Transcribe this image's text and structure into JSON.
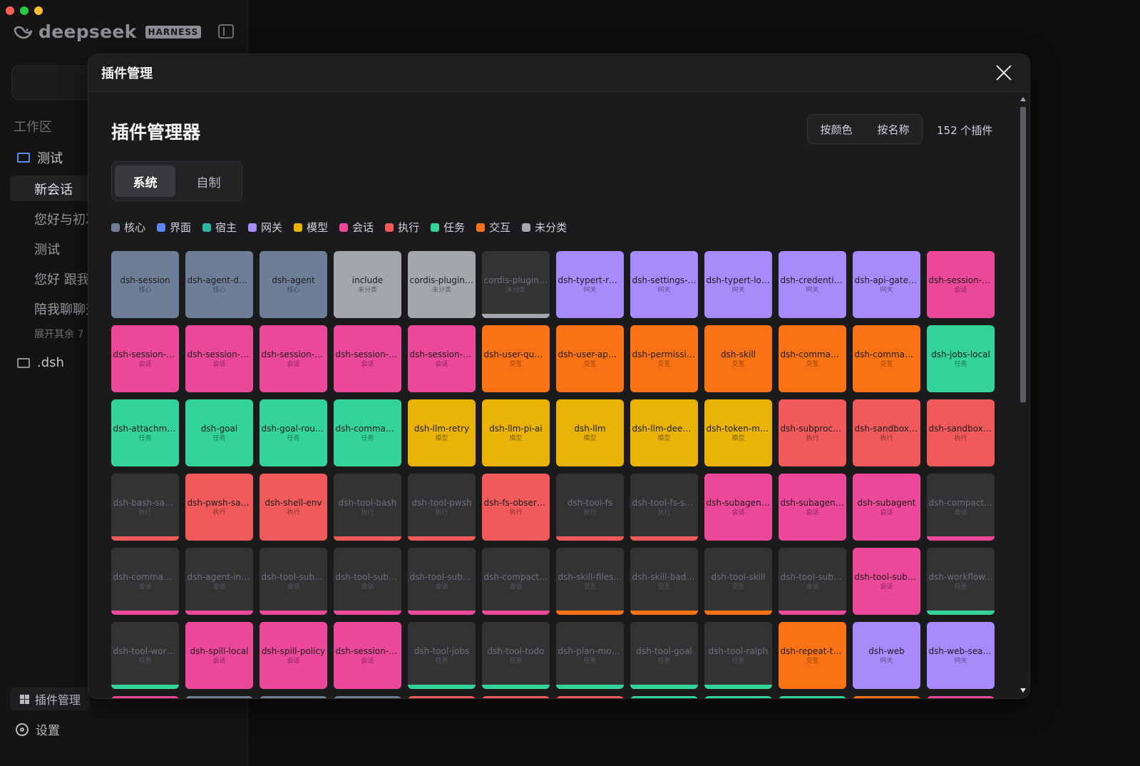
{
  "brand": {
    "name": "deepseek",
    "badge": "HARNESS"
  },
  "sidebar": {
    "workspace_title": "工作区",
    "items": [
      {
        "label": "测试",
        "type": "folder"
      },
      {
        "label": "新会话",
        "type": "chat"
      },
      {
        "label": "您好与初次",
        "type": "chat"
      },
      {
        "label": "测试",
        "type": "chat"
      },
      {
        "label": "您好 跟我",
        "type": "chat"
      },
      {
        "label": "陪我聊聊天",
        "type": "chat"
      },
      {
        "label": "展开其余 7",
        "type": "more"
      },
      {
        "label": ".dsh",
        "type": "folder"
      }
    ],
    "plugin_manager": "插件管理",
    "settings": "设置"
  },
  "modal": {
    "title": "插件管理",
    "heading": "插件管理器",
    "sort_by_color": "按颜色",
    "sort_by_name": "按名称",
    "count": "152 个插件",
    "tabs": [
      "系统",
      "自制"
    ],
    "active_tab": "系统"
  },
  "colors": {
    "核心": "#6f7e97",
    "界面": "#5b84f0",
    "宿主": "#2bb8a3",
    "网关": "#a78bfa",
    "模型": "#eab308",
    "会话": "#ec4899",
    "执行": "#f05a5a",
    "任务": "#34d399",
    "交互": "#f97316",
    "未分类": "#a3a6ab"
  },
  "legend": [
    "核心",
    "界面",
    "宿主",
    "网关",
    "模型",
    "会话",
    "执行",
    "任务",
    "交互",
    "未分类"
  ],
  "plugins": [
    {
      "name": "dsh-session",
      "cat": "核心",
      "on": true
    },
    {
      "name": "dsh-agent-def...",
      "cat": "核心",
      "on": true
    },
    {
      "name": "dsh-agent",
      "cat": "核心",
      "on": true
    },
    {
      "name": "include",
      "cat": "未分类",
      "on": true
    },
    {
      "name": "cordis-plugin-...",
      "cat": "未分类",
      "on": true
    },
    {
      "name": "cordis-plugin-...",
      "cat": "未分类",
      "on": false
    },
    {
      "name": "dsh-typert-re...",
      "cat": "网关",
      "on": true
    },
    {
      "name": "dsh-settings-file",
      "cat": "网关",
      "on": true
    },
    {
      "name": "dsh-typert-loa...",
      "cat": "网关",
      "on": true
    },
    {
      "name": "dsh-credential...",
      "cat": "网关",
      "on": true
    },
    {
      "name": "dsh-api-gatew...",
      "cat": "网关",
      "on": true
    },
    {
      "name": "dsh-session-ti...",
      "cat": "会话",
      "on": true
    },
    {
      "name": "dsh-session-ti...",
      "cat": "会话",
      "on": true
    },
    {
      "name": "dsh-session-p...",
      "cat": "会话",
      "on": true
    },
    {
      "name": "dsh-session-q...",
      "cat": "会话",
      "on": true
    },
    {
      "name": "dsh-session-p...",
      "cat": "会话",
      "on": true
    },
    {
      "name": "dsh-session-te...",
      "cat": "会话",
      "on": true
    },
    {
      "name": "dsh-user-ques...",
      "cat": "交互",
      "on": true
    },
    {
      "name": "dsh-user-appr...",
      "cat": "交互",
      "on": true
    },
    {
      "name": "dsh-permissio...",
      "cat": "交互",
      "on": true
    },
    {
      "name": "dsh-skill",
      "cat": "交互",
      "on": true
    },
    {
      "name": "dsh-commands",
      "cat": "交互",
      "on": true
    },
    {
      "name": "dsh-command...",
      "cat": "交互",
      "on": true
    },
    {
      "name": "dsh-jobs-local",
      "cat": "任务",
      "on": true
    },
    {
      "name": "dsh-attachme...",
      "cat": "任务",
      "on": true
    },
    {
      "name": "dsh-goal",
      "cat": "任务",
      "on": true
    },
    {
      "name": "dsh-goal-roun...",
      "cat": "任务",
      "on": true
    },
    {
      "name": "dsh-command...",
      "cat": "任务",
      "on": true
    },
    {
      "name": "dsh-llm-retry",
      "cat": "模型",
      "on": true
    },
    {
      "name": "dsh-llm-pi-ai",
      "cat": "模型",
      "on": true
    },
    {
      "name": "dsh-llm",
      "cat": "模型",
      "on": true
    },
    {
      "name": "dsh-llm-deeps...",
      "cat": "模型",
      "on": true
    },
    {
      "name": "dsh-token-me...",
      "cat": "模型",
      "on": true
    },
    {
      "name": "dsh-subproce...",
      "cat": "执行",
      "on": true
    },
    {
      "name": "dsh-sandbox-l...",
      "cat": "执行",
      "on": true
    },
    {
      "name": "dsh-sandbox-...",
      "cat": "执行",
      "on": true
    },
    {
      "name": "dsh-bash-san...",
      "cat": "执行",
      "on": false
    },
    {
      "name": "dsh-pwsh-san...",
      "cat": "执行",
      "on": true
    },
    {
      "name": "dsh-shell-env",
      "cat": "执行",
      "on": true
    },
    {
      "name": "dsh-tool-bash",
      "cat": "执行",
      "on": false
    },
    {
      "name": "dsh-tool-pwsh",
      "cat": "执行",
      "on": false
    },
    {
      "name": "dsh-fs-observ...",
      "cat": "执行",
      "on": true
    },
    {
      "name": "dsh-tool-fs",
      "cat": "执行",
      "on": false
    },
    {
      "name": "dsh-tool-fs-se...",
      "cat": "执行",
      "on": false
    },
    {
      "name": "dsh-subagent-...",
      "cat": "会话",
      "on": true
    },
    {
      "name": "dsh-subagent-...",
      "cat": "会话",
      "on": true
    },
    {
      "name": "dsh-subagent",
      "cat": "会话",
      "on": true
    },
    {
      "name": "dsh-compacti...",
      "cat": "会话",
      "on": false
    },
    {
      "name": "dsh-command...",
      "cat": "会话",
      "on": false
    },
    {
      "name": "dsh-agent-inst...",
      "cat": "会话",
      "on": false
    },
    {
      "name": "dsh-tool-suba...",
      "cat": "会话",
      "on": false
    },
    {
      "name": "dsh-tool-suba...",
      "cat": "会话",
      "on": false
    },
    {
      "name": "dsh-tool-suba...",
      "cat": "会话",
      "on": false
    },
    {
      "name": "dsh-compacti...",
      "cat": "会话",
      "on": false
    },
    {
      "name": "dsh-skill-filesy...",
      "cat": "交互",
      "on": false
    },
    {
      "name": "dsh-skill-badge",
      "cat": "交互",
      "on": false
    },
    {
      "name": "dsh-tool-skill",
      "cat": "交互",
      "on": false
    },
    {
      "name": "dsh-tool-suba...",
      "cat": "会话",
      "on": false
    },
    {
      "name": "dsh-tool-suba...",
      "cat": "会话",
      "on": true
    },
    {
      "name": "dsh-workflow...",
      "cat": "任务",
      "on": false
    },
    {
      "name": "dsh-tool-work...",
      "cat": "任务",
      "on": false
    },
    {
      "name": "dsh-spill-local",
      "cat": "会话",
      "on": true
    },
    {
      "name": "dsh-spill-policy",
      "cat": "会话",
      "on": true
    },
    {
      "name": "dsh-session-c...",
      "cat": "会话",
      "on": true
    },
    {
      "name": "dsh-tool-jobs",
      "cat": "任务",
      "on": false
    },
    {
      "name": "dsh-tool-todo",
      "cat": "任务",
      "on": false
    },
    {
      "name": "dsh-plan-mode",
      "cat": "任务",
      "on": false
    },
    {
      "name": "dsh-tool-goal",
      "cat": "任务",
      "on": false
    },
    {
      "name": "dsh-tool-ralph",
      "cat": "任务",
      "on": false
    },
    {
      "name": "dsh-repeat-to...",
      "cat": "交互",
      "on": true
    },
    {
      "name": "dsh-web",
      "cat": "网关",
      "on": true
    },
    {
      "name": "dsh-web-sear...",
      "cat": "网关",
      "on": true
    }
  ],
  "partial_row_cats": [
    "会话",
    "核心",
    "核心",
    "核心",
    "执行",
    "执行",
    "执行",
    "任务",
    "任务",
    "任务",
    "交互",
    "会话"
  ]
}
